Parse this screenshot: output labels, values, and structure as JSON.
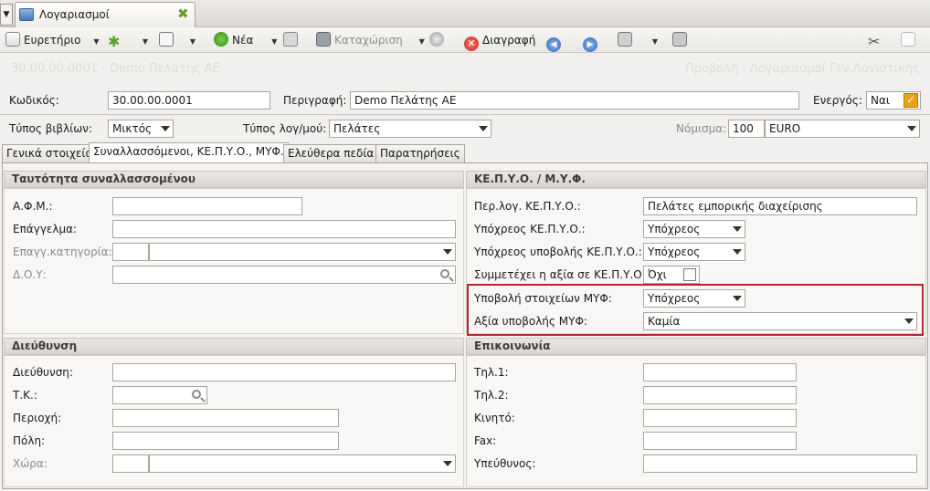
{
  "tab": {
    "title": "Λογαριασμοί"
  },
  "toolbar": {
    "index_label": "Ευρετήριο",
    "new_label": "Νέα",
    "save_label": "Καταχώριση",
    "delete_label": "Διαγραφή"
  },
  "header": {
    "ghost_left": "30.00.00.0001 - Demo Πελάτης ΑΕ",
    "ghost_right": "Προβολή : Λογαριασμοί Γεν.Λογιστικής"
  },
  "form": {
    "code_label": "Κωδικός:",
    "code_value": "30.00.00.0001",
    "desc_label": "Περιγραφή:",
    "desc_value": "Demo Πελάτης ΑΕ",
    "active_label": "Ενεργός:",
    "active_value": "Ναι",
    "book_type_label": "Τύπος βιβλίων:",
    "book_type_value": "Μικτός",
    "acc_type_label": "Τύπος λογ/μού:",
    "acc_type_value": "Πελάτες",
    "currency_label": "Νόμισμα:",
    "currency_code": "100",
    "currency_value": "EURO"
  },
  "tabs": [
    {
      "label": "Γενικά στοιχεία"
    },
    {
      "label": "Συναλλασσόμενοι, ΚΕ.Π.Υ.Ο., ΜΥΦ."
    },
    {
      "label": "Ελεύθερα πεδία"
    },
    {
      "label": "Παρατηρήσεις"
    }
  ],
  "identity": {
    "title": "Ταυτότητα συναλλασσομένου",
    "afm_label": "Α.Φ.Μ.:",
    "profession_label": "Επάγγελμα:",
    "category_label": "Επαγγ.κατηγορία:",
    "doy_label": "Δ.Ο.Υ:"
  },
  "kepyo": {
    "title": "ΚΕ.Π.Υ.Ο. / Μ.Υ.Φ.",
    "per_label": "Περ.λογ. ΚΕ.Π.Υ.Ο.:",
    "per_value": "Πελάτες εμπορικής διαχείρισης",
    "obliged_label": "Υπόχρεος ΚΕ.Π.Υ.Ο.:",
    "obliged_value": "Υπόχρεος",
    "obliged_sub_label": "Υπόχρεος υποβολής ΚΕ.Π.Υ.Ο.:",
    "obliged_sub_value": "Υπόχρεος",
    "participates_label": "Συμμετέχει η αξία σε ΚΕ.Π.Υ.Ο.:",
    "participates_value": "Όχι",
    "myf_sub_label": "Υποβολή στοιχείων ΜΥΦ:",
    "myf_sub_value": "Υπόχρεος",
    "myf_value_label": "Αξία υποβολής ΜΥΦ:",
    "myf_value_value": "Καμία"
  },
  "address": {
    "title": "Διεύθυνση",
    "street_label": "Διεύθυνση:",
    "zip_label": "Τ.Κ.:",
    "area_label": "Περιοχή:",
    "city_label": "Πόλη:",
    "country_label": "Χώρα:"
  },
  "contact": {
    "title": "Επικοινωνία",
    "tel1_label": "Τηλ.1:",
    "tel2_label": "Τηλ.2:",
    "mobile_label": "Κινητό:",
    "fax_label": "Fax:",
    "responsible_label": "Υπεύθυνος:"
  },
  "colors": {
    "highlight_border": "#b4272b",
    "active_check": "#e8a317"
  }
}
